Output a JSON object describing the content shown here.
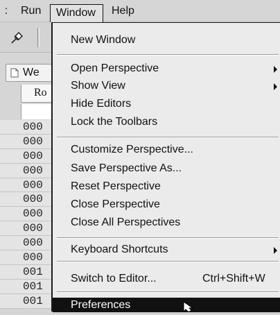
{
  "menubar": {
    "cut_label": ":",
    "run_label": "Run",
    "window_label": "Window",
    "help_label": "Help"
  },
  "toolbar": {
    "pin_icon": "pin-icon"
  },
  "panel": {
    "tab_label": "We",
    "column_header": "Ro",
    "rows": [
      "000",
      "000",
      "000",
      "000",
      "000",
      "000",
      "000",
      "000",
      "000",
      "000",
      "001",
      "001",
      "001"
    ]
  },
  "window_menu": {
    "items": [
      {
        "label": "New Window"
      },
      {
        "label": "Open Perspective",
        "submenu": true
      },
      {
        "label": "Show View",
        "submenu": true
      },
      {
        "label": "Hide Editors"
      },
      {
        "label": "Lock the Toolbars"
      },
      {
        "label": "Customize Perspective..."
      },
      {
        "label": "Save Perspective As..."
      },
      {
        "label": "Reset Perspective"
      },
      {
        "label": "Close Perspective"
      },
      {
        "label": "Close All Perspectives"
      },
      {
        "label": "Keyboard Shortcuts",
        "submenu": true
      },
      {
        "label": "Switch to Editor...",
        "shortcut": "Ctrl+Shift+W"
      },
      {
        "label": "Preferences",
        "highlighted": true
      }
    ]
  },
  "colors": {
    "menu_background": "#ebebeb",
    "highlight_background": "#111111",
    "highlight_text": "#ffffff",
    "menubar_background": "#d6d6d6"
  }
}
